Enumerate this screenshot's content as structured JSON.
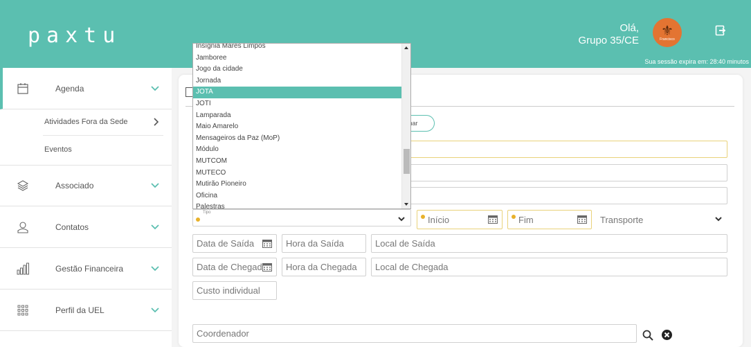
{
  "header": {
    "logo": "paxtu",
    "greeting_line1": "Olá,",
    "greeting_line2": "Grupo 35/CE",
    "avatar_text": "Francisco",
    "session": "Sua sessão expira em: 28:40 minutos",
    "color": "#5bbfb0"
  },
  "sidebar": {
    "agenda": "Agenda",
    "sub_items": [
      "Atividades Fora da Sede",
      "Eventos"
    ],
    "associado": "Associado",
    "contatos": "Contatos",
    "gestao": "Gestão Financeira",
    "perfil": "Perfil da UEL"
  },
  "form": {
    "confirm_label": "mar",
    "tipo_label": "Tipo",
    "inicio": "Início",
    "fim": "Fim",
    "transporte": "Transporte",
    "data_saida": "Data de Saída",
    "hora_saida": "Hora da Saída",
    "local_saida": "Local de Saída",
    "data_chegada": "Data de Chegada",
    "hora_chegada": "Hora da Chegada",
    "local_chegada": "Local de Chegada",
    "custo": "Custo individual",
    "coordenador": "Coordenador"
  },
  "dropdown": {
    "options": [
      "Insígnia Mares Limpos",
      "Jamboree",
      "Jogo da cidade",
      "Jornada",
      "JOTA",
      "JOTI",
      "Lamparada",
      "Maio Amarelo",
      "Mensageiros da Paz (MoP)",
      "Módulo",
      "MUTCOM",
      "MUTECO",
      "Mutirão Pioneiro",
      "Oficina",
      "Palestras"
    ],
    "selected": "JOTA"
  }
}
